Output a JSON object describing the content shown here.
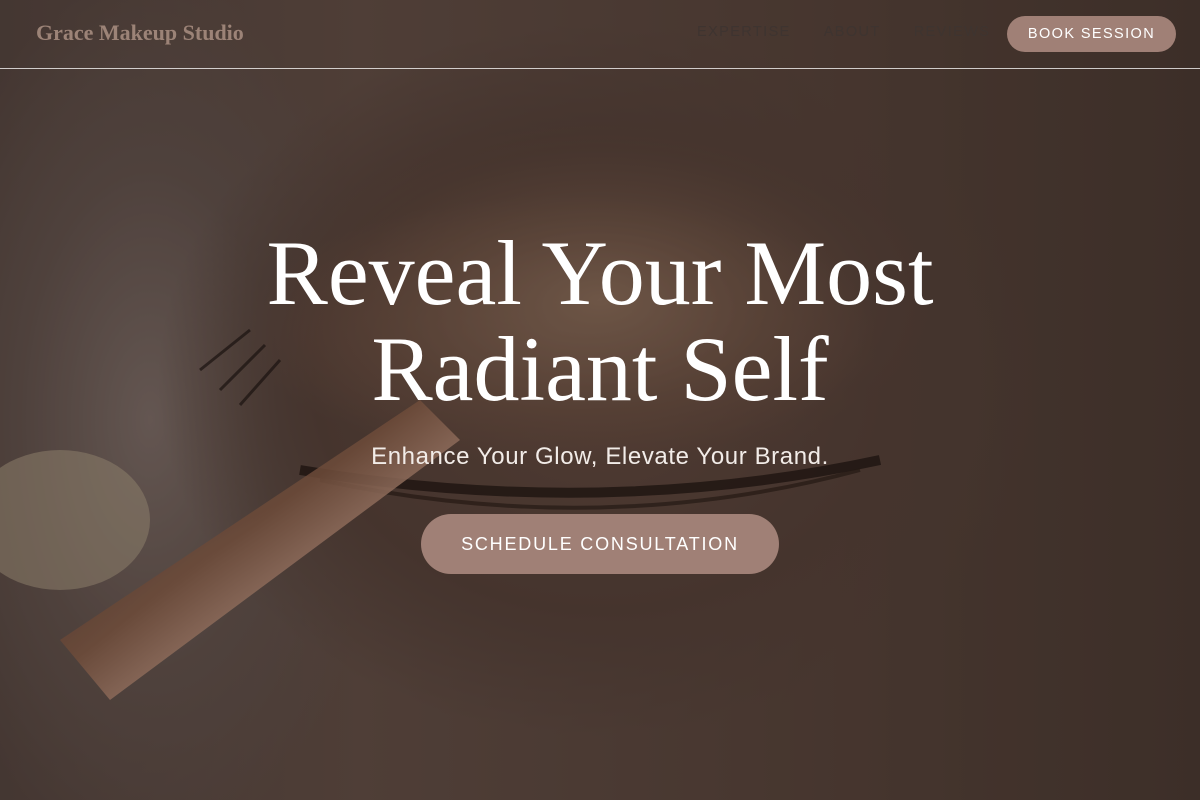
{
  "header": {
    "logo": "Grace Makeup Studio",
    "nav": [
      {
        "label": "EXPERTISE"
      },
      {
        "label": "ABOUT"
      },
      {
        "label": "REVIEWS"
      }
    ],
    "cta_label": "BOOK SESSION"
  },
  "hero": {
    "title_line1": "Reveal Your Most",
    "title_line2": "Radiant Self",
    "subtitle": "Enhance Your Glow, Elevate Your Brand.",
    "cta_label": "SCHEDULE CONSULTATION"
  },
  "colors": {
    "accent": "#a08076",
    "logo": "#9c8377",
    "text_light": "#ffffff"
  }
}
